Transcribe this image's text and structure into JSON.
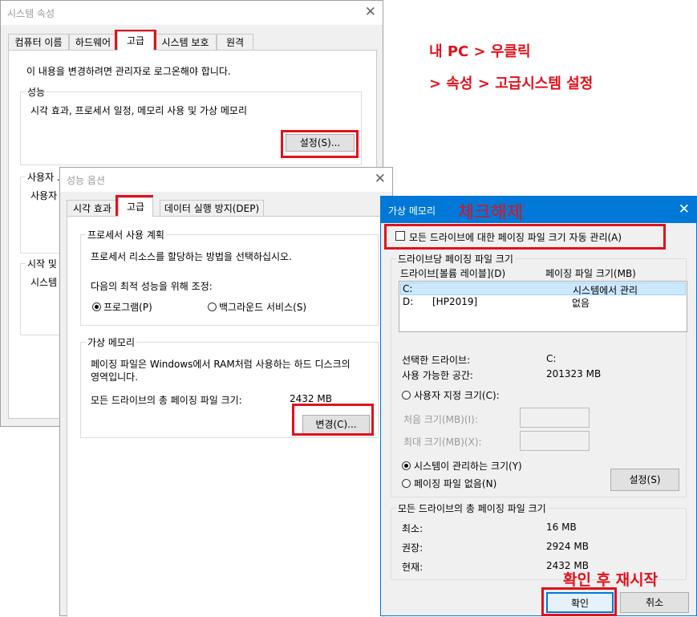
{
  "annotations": {
    "line1": "내 PC > 우클릭",
    "line2": "> 속성 > 고급시스템 설정",
    "uncheck": "체크해제",
    "confirm_restart": "확인 후 재시작"
  },
  "system_properties": {
    "title": "시스템 속성",
    "tabs": [
      "컴퓨터 이름",
      "하드웨어",
      "고급",
      "시스템 보호",
      "원격"
    ],
    "admin_note": "이 내용을 변경하려면 관리자로 로그온해야 합니다.",
    "performance_label": "성능",
    "performance_desc": "시각 효과, 프로세서 일정, 메모리 사용 및 가상 메모리",
    "settings_button": "설정(S)...",
    "user_profile_label": "사용자 ...",
    "user_profile_desc": "사용자",
    "startup_label": "시작 및",
    "startup_desc": "시스템"
  },
  "performance_options": {
    "title": "성능 옵션",
    "tabs": [
      "시각 효과",
      "고급",
      "데이터 실행 방지(DEP)"
    ],
    "cpu_group": "프로세서 사용 계획",
    "cpu_desc": "프로세서 리소스를 할당하는 방법을 선택하십시오.",
    "adjust_label": "다음의 최적 성능을 위해 조정:",
    "radio_programs": "프로그램(P)",
    "radio_background": "백그라운드 서비스(S)",
    "vm_group": "가상 메모리",
    "vm_desc_line1": "페이징 파일은 Windows에서 RAM처럼 사용하는 하드 디스크의",
    "vm_desc_line2": "영역입니다.",
    "total_label": "모든 드라이브의 총 페이징 파일 크기:",
    "total_value": "2432 MB",
    "change_button": "변경(C)..."
  },
  "virtual_memory": {
    "title": "가상 메모리",
    "auto_manage": "모든 드라이브에 대한 페이징 파일 크기 자동 관리(A)",
    "per_drive_group": "드라이브당 페이징 파일 크기",
    "col_drive": "드라이브[볼륨 레이블](D)",
    "col_size": "페이징 파일 크기(MB)",
    "drives": [
      {
        "drive": "C:",
        "label": "",
        "size": "시스템에서 관리"
      },
      {
        "drive": "D:",
        "label": "[HP2019]",
        "size": "없음"
      }
    ],
    "selected_drive_label": "선택한 드라이브:",
    "selected_drive_value": "C:",
    "free_space_label": "사용 가능한 공간:",
    "free_space_value": "201323 MB",
    "radio_custom": "사용자 지정 크기(C):",
    "initial_size": "처음 크기(MB)(I):",
    "max_size": "최대 크기(MB)(X):",
    "radio_system": "시스템이 관리하는 크기(Y)",
    "radio_none": "페이징 파일 없음(N)",
    "set_button": "설정(S)",
    "total_group": "모든 드라이브의 총 페이징 파일 크기",
    "min_label": "최소:",
    "min_value": "16 MB",
    "rec_label": "권장:",
    "rec_value": "2924 MB",
    "cur_label": "현재:",
    "cur_value": "2432 MB",
    "ok_button": "확인",
    "cancel_button": "취소"
  },
  "colors": {
    "accent": "#0078d7",
    "highlight": "#cce8ff",
    "annotation_red": "#e0121b"
  }
}
